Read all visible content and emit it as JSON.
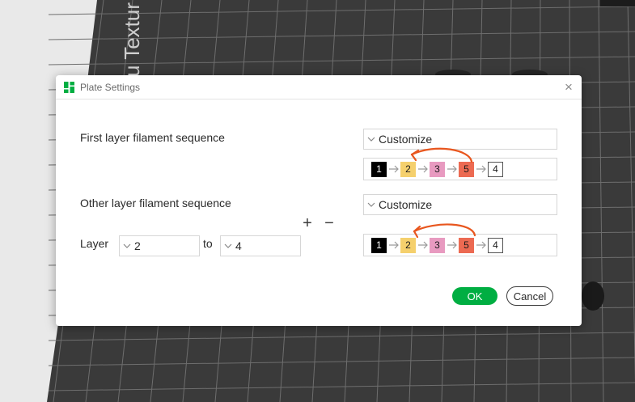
{
  "background": {
    "plate_text": "u Textur"
  },
  "dialog": {
    "title": "Plate Settings",
    "icon": "bambu-app-icon",
    "close": "close-icon"
  },
  "first_layer": {
    "label": "First layer filament sequence",
    "mode": "Customize",
    "sequence": [
      {
        "label": "1",
        "color": "#000000"
      },
      {
        "label": "2",
        "color": "#f5d06d"
      },
      {
        "label": "3",
        "color": "#e89ac0"
      },
      {
        "label": "5",
        "color": "#ec6a52"
      },
      {
        "label": "4",
        "color": "#ffffff"
      }
    ]
  },
  "other_layer": {
    "label": "Other layer filament sequence",
    "mode": "Customize",
    "layer_label": "Layer",
    "from_value": "2",
    "to_label": "to",
    "to_value": "4",
    "add_symbol": "+",
    "remove_symbol": "−",
    "sequence": [
      {
        "label": "1",
        "color": "#000000"
      },
      {
        "label": "2",
        "color": "#f5d06d"
      },
      {
        "label": "3",
        "color": "#e89ac0"
      },
      {
        "label": "5",
        "color": "#ec6a52"
      },
      {
        "label": "4",
        "color": "#ffffff"
      }
    ]
  },
  "buttons": {
    "ok": "OK",
    "cancel": "Cancel"
  },
  "colors": {
    "accent": "#00ae42",
    "annotation": "#e8561e"
  }
}
